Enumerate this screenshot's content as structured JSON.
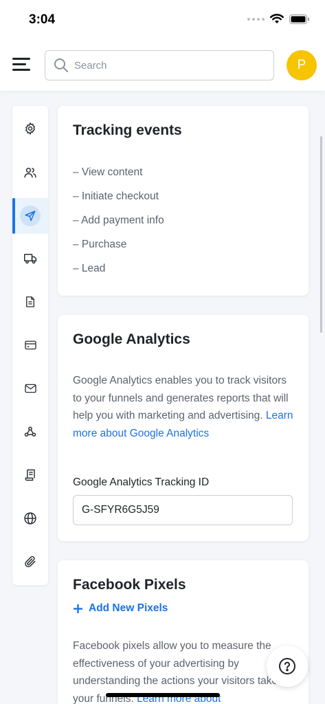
{
  "status_bar": {
    "time": "3:04"
  },
  "header": {
    "search_placeholder": "Search",
    "avatar_initial": "P",
    "avatar_color": "#f6c400"
  },
  "sidebar": {
    "items": [
      {
        "icon": "gear-icon",
        "active": false
      },
      {
        "icon": "users-icon",
        "active": false
      },
      {
        "icon": "send-icon",
        "active": true
      },
      {
        "icon": "truck-icon",
        "active": false
      },
      {
        "icon": "document-icon",
        "active": false
      },
      {
        "icon": "credit-card-icon",
        "active": false
      },
      {
        "icon": "mail-icon",
        "active": false
      },
      {
        "icon": "webhook-icon",
        "active": false
      },
      {
        "icon": "receipt-icon",
        "active": false
      },
      {
        "icon": "globe-icon",
        "active": false
      },
      {
        "icon": "paperclip-icon",
        "active": false
      }
    ]
  },
  "tracking_events": {
    "title": "Tracking events",
    "items": [
      "– View content",
      "– Initiate checkout",
      "– Add payment info",
      "– Purchase",
      "– Lead"
    ]
  },
  "google_analytics": {
    "title": "Google Analytics",
    "description": "Google Analytics enables you to track visitors to your funnels and generates reports that will help you with marketing and advertising.",
    "link_text": "Learn more about Google Analytics",
    "field_label": "Google Analytics Tracking ID",
    "field_value": "G-SFYR6G5J59"
  },
  "facebook_pixels": {
    "title": "Facebook Pixels",
    "add_label": "Add New Pixels",
    "description": "Facebook pixels allow you to measure the effectiveness of your advertising by understanding the actions your visitors take on your funnels.",
    "link_text": "Learn more about"
  },
  "colors": {
    "accent": "#1a73e8",
    "background": "#f4f6f9"
  }
}
